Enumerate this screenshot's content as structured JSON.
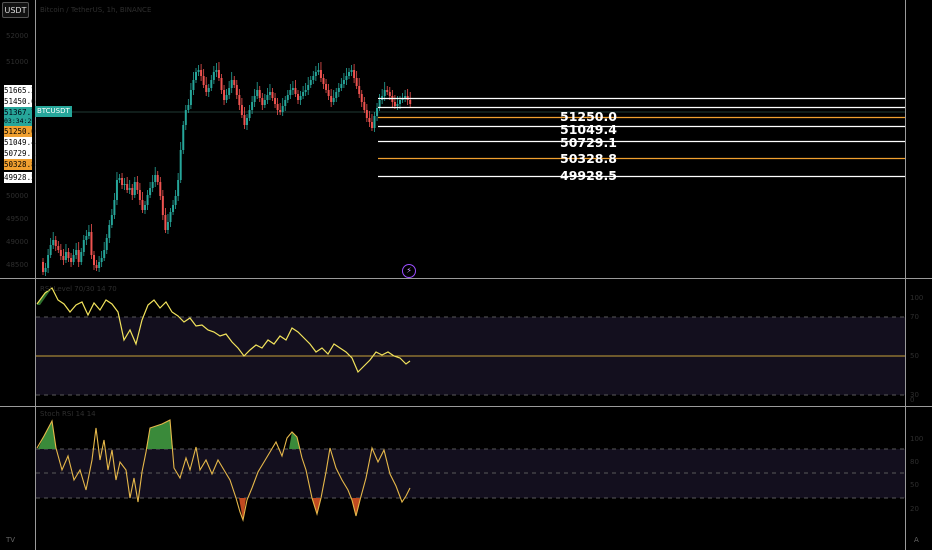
{
  "toolbar": {
    "currency_label": "USDT"
  },
  "header": {
    "title": "Bitcoin / TetherUS, 1h, BINANCE"
  },
  "price_scale": {
    "ticks": [
      "52000",
      "51000",
      "50000",
      "49500",
      "49000",
      "48500"
    ],
    "current_price": "51367.7",
    "countdown": "03:34:29",
    "symbol": "BTCUSDT",
    "tags": [
      {
        "text": "51665.2",
        "kind": "white"
      },
      {
        "text": "51450.6",
        "kind": "white"
      },
      {
        "text": "51250.0",
        "kind": "orange"
      },
      {
        "text": "51049.4",
        "kind": "white"
      },
      {
        "text": "50729.1",
        "kind": "white"
      },
      {
        "text": "50328.8",
        "kind": "orange"
      },
      {
        "text": "49928.5",
        "kind": "white"
      }
    ]
  },
  "levels": [
    {
      "price": "51665.2",
      "color": "#ffffff",
      "label": ""
    },
    {
      "price": "51450.6",
      "color": "#ffffff",
      "label": ""
    },
    {
      "price": "51250.0",
      "color": "#f0a030",
      "label": "51250.0"
    },
    {
      "price": "51049.4",
      "color": "#ffffff",
      "label": "51049.4"
    },
    {
      "price": "50729.1",
      "color": "#ffffff",
      "label": "50729.1"
    },
    {
      "price": "50328.8",
      "color": "#f0a030",
      "label": "50328.8"
    },
    {
      "price": "49928.5",
      "color": "#ffffff",
      "label": "49928.5"
    }
  ],
  "panes": {
    "rsi": {
      "title": "RSI Level 70/30 14 70",
      "ticks": [
        "100",
        "70",
        "50",
        "30",
        "0"
      ]
    },
    "stoch": {
      "title": "Stoch RSI 14 14",
      "ticks": [
        "100",
        "80",
        "50",
        "20",
        "0"
      ]
    }
  },
  "bottom": {
    "logo": "TV",
    "corner": "A"
  },
  "colors": {
    "up": "#26a69a",
    "down": "#ef5350",
    "osc_line": "#f2e35c",
    "fill_green": "#3a8a3a",
    "fill_red": "#c04a20",
    "band": "#1a1424"
  }
}
